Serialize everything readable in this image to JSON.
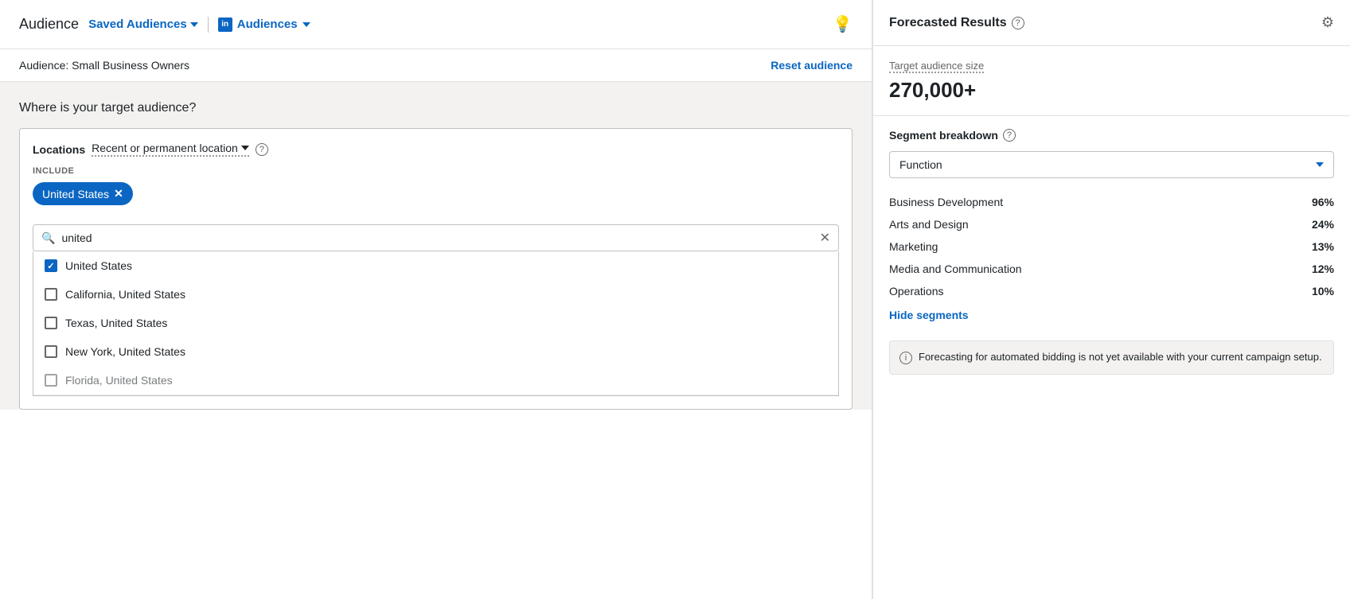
{
  "header": {
    "title": "Audience",
    "saved_audiences_label": "Saved Audiences",
    "audiences_label": "Audiences",
    "li_icon_text": "in"
  },
  "audience_name": {
    "label": "Audience: Small Business Owners",
    "reset_label": "Reset audience"
  },
  "where_section": {
    "title": "Where is your target audience?",
    "locations_label": "Locations",
    "location_type": "Recent or permanent location",
    "help_tooltip": "?",
    "include_label": "INCLUDE",
    "selected_tag": "United States",
    "search_placeholder": "united",
    "clear_label": "×"
  },
  "dropdown_items": [
    {
      "label": "United States",
      "checked": true
    },
    {
      "label": "California, United States",
      "checked": false
    },
    {
      "label": "Texas, United States",
      "checked": false
    },
    {
      "label": "New York, United States",
      "checked": false
    },
    {
      "label": "Florida, United States",
      "checked": false
    }
  ],
  "forecasted": {
    "title": "Forecasted Results",
    "target_audience_label": "Target audience size",
    "target_audience_size": "270,000+",
    "segment_breakdown_label": "Segment breakdown",
    "segment_dropdown_value": "Function",
    "segments": [
      {
        "name": "Business Development",
        "pct": "96%"
      },
      {
        "name": "Arts and Design",
        "pct": "24%"
      },
      {
        "name": "Marketing",
        "pct": "13%"
      },
      {
        "name": "Media and Communication",
        "pct": "12%"
      },
      {
        "name": "Operations",
        "pct": "10%"
      }
    ],
    "hide_segments_label": "Hide segments",
    "forecasting_note": "Forecasting for automated bidding is not yet available with your current campaign setup."
  }
}
